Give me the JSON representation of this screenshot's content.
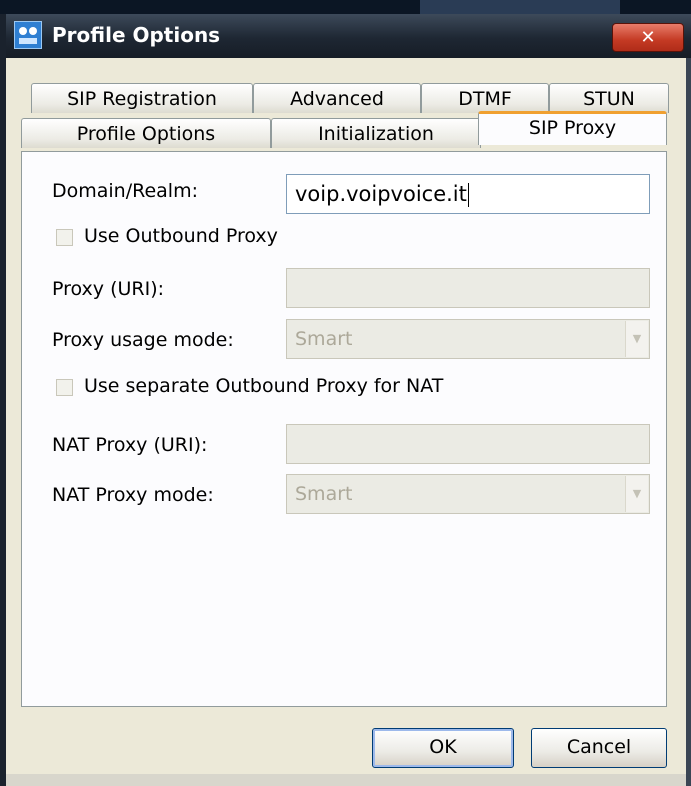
{
  "window": {
    "title": "Profile Options",
    "close_glyph": "✕"
  },
  "tabs": {
    "row1": [
      {
        "label": "SIP Registration"
      },
      {
        "label": "Advanced"
      },
      {
        "label": "DTMF"
      },
      {
        "label": "STUN"
      }
    ],
    "row2": [
      {
        "label": "Profile Options"
      },
      {
        "label": "Initialization"
      },
      {
        "label": "SIP Proxy",
        "active": true
      }
    ]
  },
  "form": {
    "domain_label": "Domain/Realm:",
    "domain_value": "voip.voipvoice.it",
    "use_outbound_label": "Use Outbound Proxy",
    "use_outbound_checked": false,
    "proxy_uri_label": "Proxy (URI):",
    "proxy_uri_value": "",
    "proxy_mode_label": "Proxy usage mode:",
    "proxy_mode_value": "Smart",
    "use_separate_label": "Use separate Outbound Proxy for NAT",
    "use_separate_checked": false,
    "nat_uri_label": "NAT Proxy (URI):",
    "nat_uri_value": "",
    "nat_mode_label": "NAT Proxy mode:",
    "nat_mode_value": "Smart"
  },
  "buttons": {
    "ok": "OK",
    "cancel": "Cancel"
  },
  "colors": {
    "title_bar": "#1e2733",
    "close_button": "#c43a24",
    "active_tab_accent": "#f0a030",
    "dialog_bg": "#ece9d8"
  },
  "icons": {
    "app": "app-logo-icon",
    "close": "close-icon",
    "dropdown": "chevron-down-icon"
  }
}
